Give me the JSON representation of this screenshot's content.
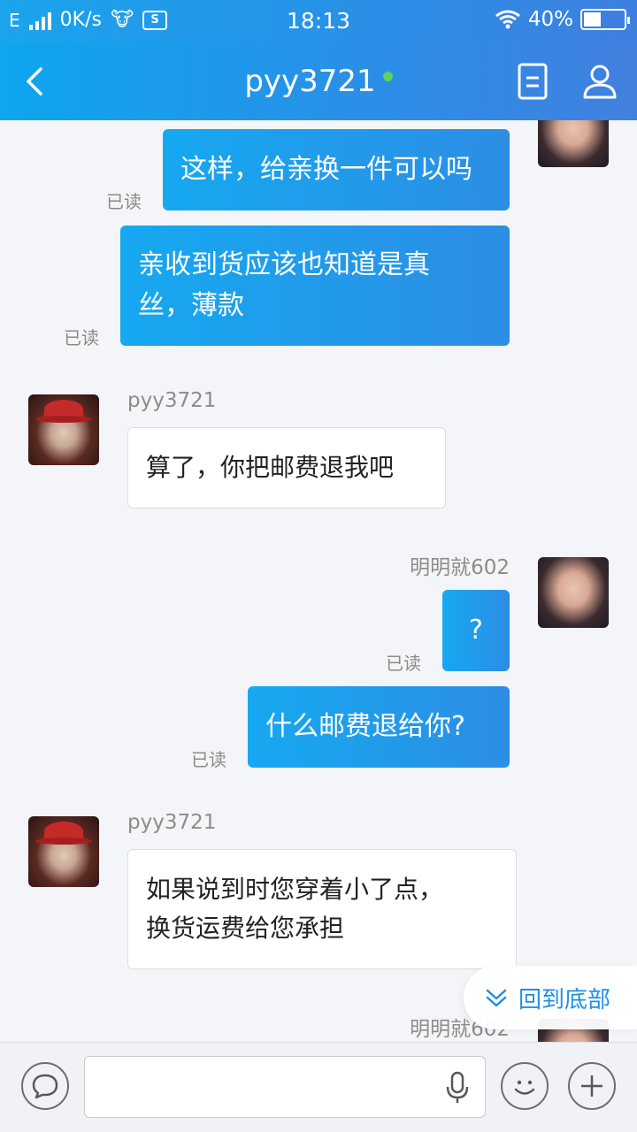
{
  "status_bar": {
    "carrier": "E",
    "speed": "0K/s",
    "time": "18:13",
    "battery": "40%"
  },
  "header": {
    "title": "pyy3721"
  },
  "messages": [
    {
      "side": "out",
      "text": "这样，给亲换一件可以吗",
      "status": "已读"
    },
    {
      "side": "out",
      "text_lines": [
        "亲收到货应该也知道是真",
        "丝，薄款"
      ],
      "status": "已读"
    },
    {
      "side": "in",
      "sender": "pyy3721",
      "text": "算了，你把邮费退我吧"
    },
    {
      "side": "out",
      "sender": "明明就602",
      "text": "?",
      "status": "已读"
    },
    {
      "side": "out",
      "text": "什么邮费退给你?",
      "status": "已读"
    },
    {
      "side": "in",
      "sender": "pyy3721",
      "text_lines": [
        "如果说到时您穿着小了点，",
        "换货运费给您承担"
      ]
    },
    {
      "side": "out",
      "sender": "明明就602"
    }
  ],
  "back_to_bottom_label": "回到底部",
  "colors": {
    "accent": "#1f8fe6",
    "online": "#5ed35e"
  }
}
